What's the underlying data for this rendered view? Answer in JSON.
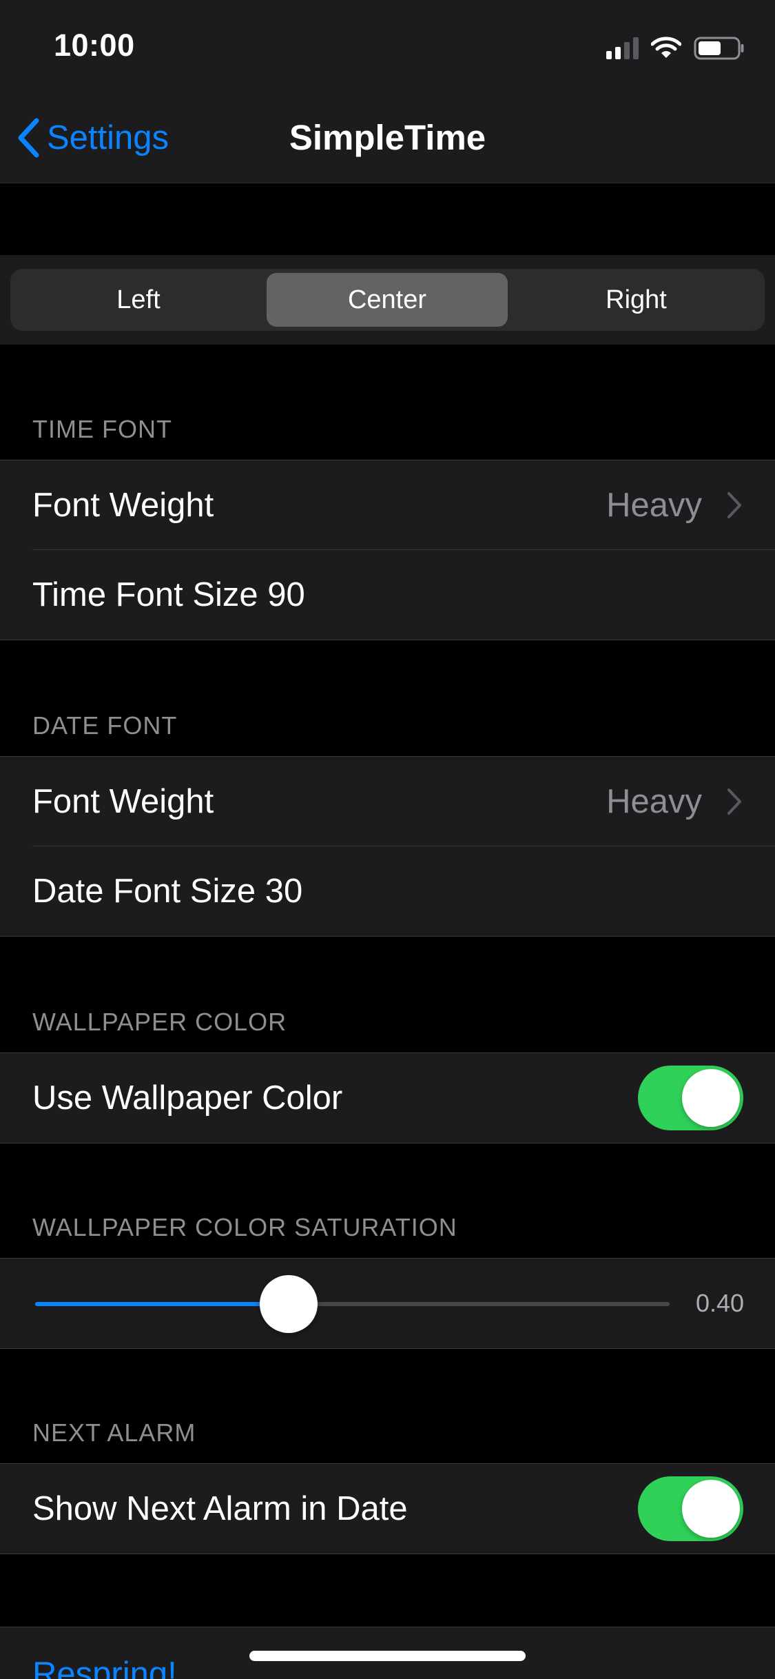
{
  "status_bar": {
    "time": "10:00",
    "battery_level": 0.6
  },
  "nav": {
    "back_label": "Settings",
    "title": "SimpleTime"
  },
  "alignment_segments": {
    "options": [
      "Left",
      "Center",
      "Right"
    ],
    "selected": "Center"
  },
  "time_font": {
    "header": "TIME FONT",
    "font_weight_label": "Font Weight",
    "font_weight_value": "Heavy",
    "size_label": "Time Font Size  90"
  },
  "date_font": {
    "header": "DATE FONT",
    "font_weight_label": "Font Weight",
    "font_weight_value": "Heavy",
    "size_label": "Date Font Size  30"
  },
  "wallpaper_color": {
    "header": "WALLPAPER COLOR",
    "use_label": "Use Wallpaper Color",
    "use_enabled": true
  },
  "wallpaper_saturation": {
    "header": "WALLPAPER COLOR SATURATION",
    "value": 0.4,
    "value_text": "0.40"
  },
  "next_alarm": {
    "header": "NEXT ALARM",
    "show_label": "Show Next Alarm in Date",
    "show_enabled": true
  },
  "respring_label": "Respring!",
  "colors": {
    "accent": "#0a84ff",
    "toggle_on": "#30d158",
    "background": "#000000",
    "cell_background": "#1c1c1e",
    "secondary_text": "#8e8e93"
  }
}
